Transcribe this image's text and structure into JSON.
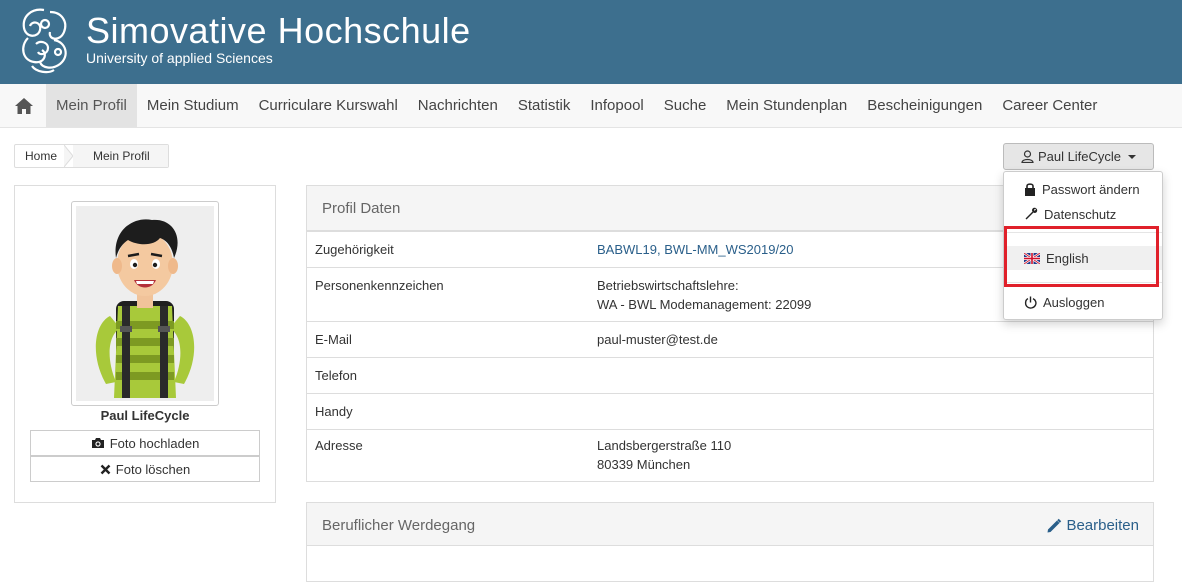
{
  "header": {
    "title": "Simovative  Hochschule",
    "subtitle": "University of applied Sciences",
    "bg_color": "#3d6f8e"
  },
  "nav": {
    "home_icon": "home-icon",
    "items": [
      {
        "label": "Mein Profil",
        "active": true
      },
      {
        "label": "Mein Studium"
      },
      {
        "label": "Curriculare Kurswahl"
      },
      {
        "label": "Nachrichten"
      },
      {
        "label": "Statistik"
      },
      {
        "label": "Infopool"
      },
      {
        "label": "Suche"
      },
      {
        "label": "Mein Stundenplan"
      },
      {
        "label": "Bescheinigungen"
      },
      {
        "label": "Career Center"
      }
    ]
  },
  "breadcrumb": [
    "Home",
    "Mein Profil"
  ],
  "user_menu": {
    "button_label": "Paul LifeCycle",
    "items": [
      {
        "label": "Passwort ändern",
        "icon": "lock-icon"
      },
      {
        "label": "Datenschutz",
        "icon": "wrench-icon"
      },
      {
        "label": "English",
        "icon": "uk-flag-icon"
      },
      {
        "label": "Ausloggen",
        "icon": "power-icon"
      }
    ],
    "highlight_color": "#e0202a"
  },
  "profile": {
    "name": "Paul LifeCycle",
    "upload_label": "Foto hochladen",
    "delete_label": "Foto löschen"
  },
  "profile_data": {
    "title": "Profil Daten",
    "rows": [
      {
        "label": "Zugehörigkeit",
        "value": "BABWL19, BWL-MM_WS2019/20"
      },
      {
        "label": "Personenkennzeichen",
        "value": "Betriebswirtschaftslehre:",
        "value2": "WA - BWL Modemanagement: 22099"
      },
      {
        "label": "E-Mail",
        "value": "paul-muster@test.de"
      },
      {
        "label": "Telefon",
        "value": ""
      },
      {
        "label": "Handy",
        "value": ""
      },
      {
        "label": "Adresse",
        "value": "Landsbergerstraße 110",
        "value2": "80339 München"
      }
    ]
  },
  "career": {
    "title": "Beruflicher Werdegang",
    "edit_label": "Bearbeiten"
  }
}
